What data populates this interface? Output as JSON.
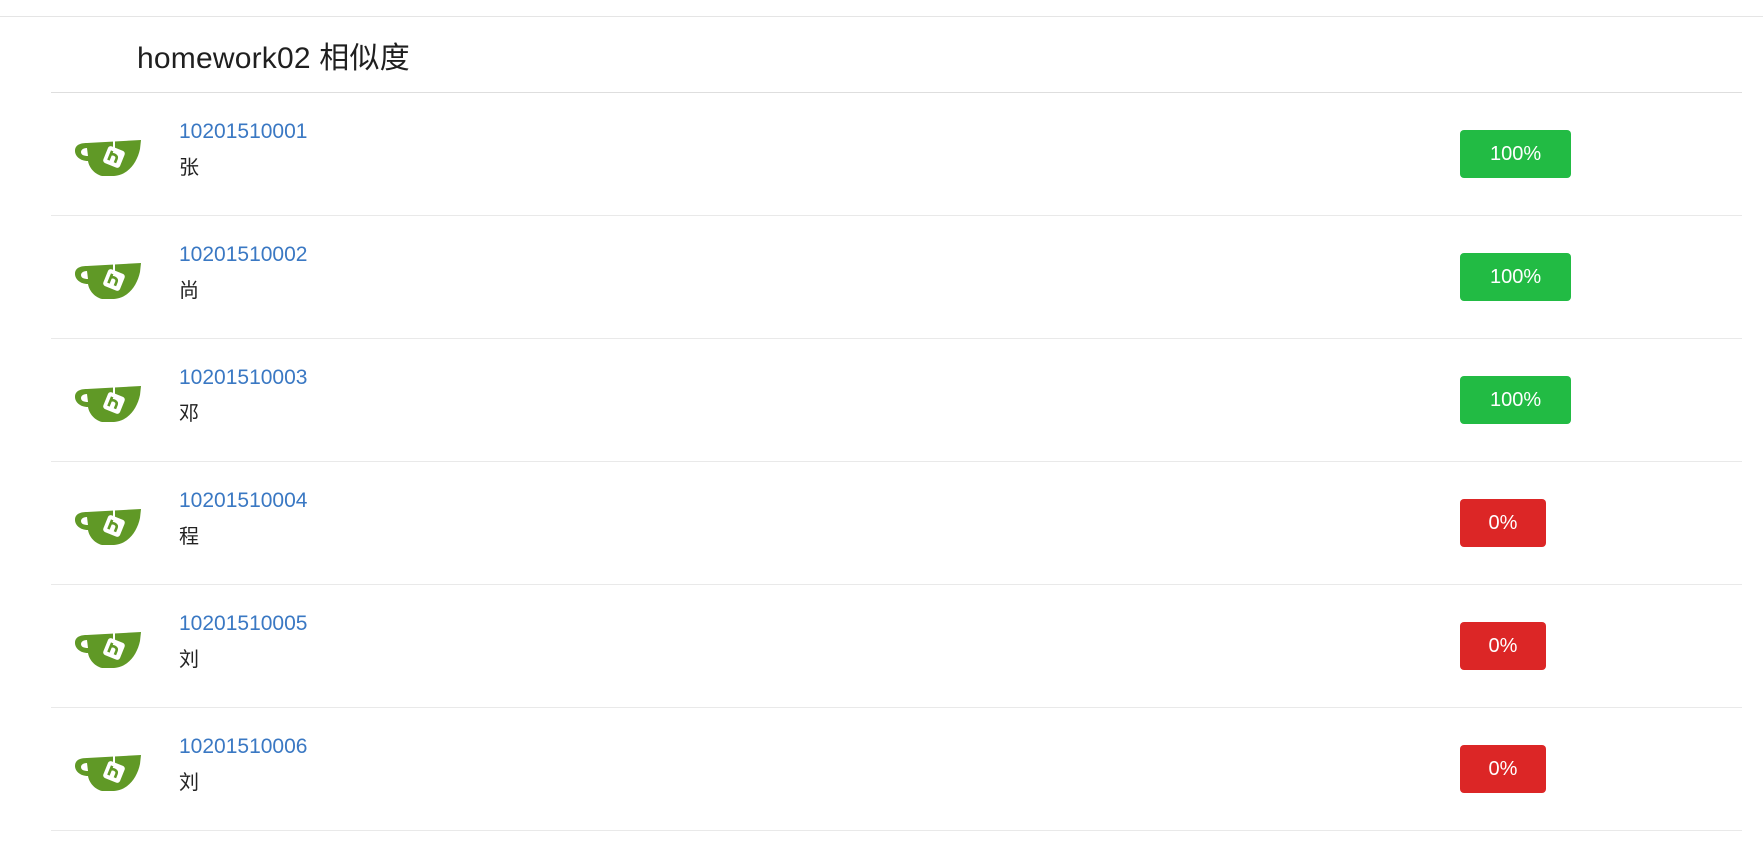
{
  "header": {
    "title": "homework02 相似度"
  },
  "colors": {
    "high": "#22bb44",
    "low": "#dc2626",
    "link": "#3a78c3",
    "logo_green": "#609926"
  },
  "items": [
    {
      "id": "10201510001",
      "name": "张",
      "similarity": "100%",
      "level": "high"
    },
    {
      "id": "10201510002",
      "name": "尚",
      "similarity": "100%",
      "level": "high"
    },
    {
      "id": "10201510003",
      "name": "邓",
      "similarity": "100%",
      "level": "high"
    },
    {
      "id": "10201510004",
      "name": "程",
      "similarity": "0%",
      "level": "low"
    },
    {
      "id": "10201510005",
      "name": "刘",
      "similarity": "0%",
      "level": "low"
    },
    {
      "id": "10201510006",
      "name": "刘",
      "similarity": "0%",
      "level": "low"
    }
  ]
}
